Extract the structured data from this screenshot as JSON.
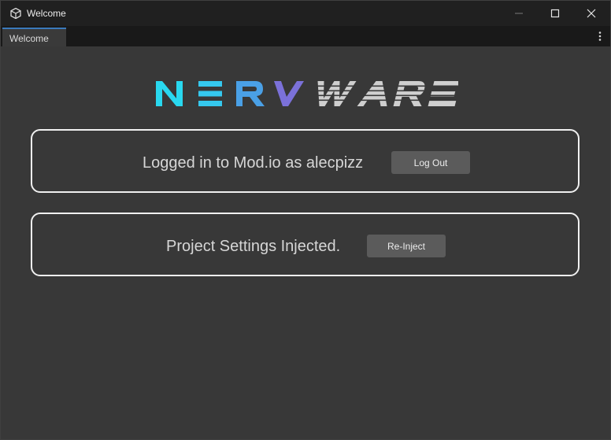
{
  "window": {
    "title": "Welcome",
    "app_icon": "unity-logo-icon"
  },
  "controls": {
    "minimize": "minimize-icon",
    "maximize": "maximize-icon",
    "close": "close-icon"
  },
  "tabs": [
    {
      "label": "Welcome",
      "active": true
    }
  ],
  "tab_menu": "kebab-menu-icon",
  "logo": {
    "text": "NERVWARE"
  },
  "account_panel": {
    "status_text": "Logged in to Mod.io as alecpizz",
    "button_label": "Log Out"
  },
  "project_panel": {
    "status_text": "Project Settings Injected.",
    "button_label": "Re-Inject"
  },
  "colors": {
    "background": "#383838",
    "titlebar": "#202020",
    "tabbar": "#191919",
    "tab_accent": "#3a79bb",
    "panel_border": "#f0f0f0",
    "button": "#5b5b5b",
    "logo_cyan": "#29d8ef",
    "logo_blue": "#4aa0e6",
    "logo_purple": "#7b71d9",
    "logo_gray": "#cfcfcf"
  }
}
